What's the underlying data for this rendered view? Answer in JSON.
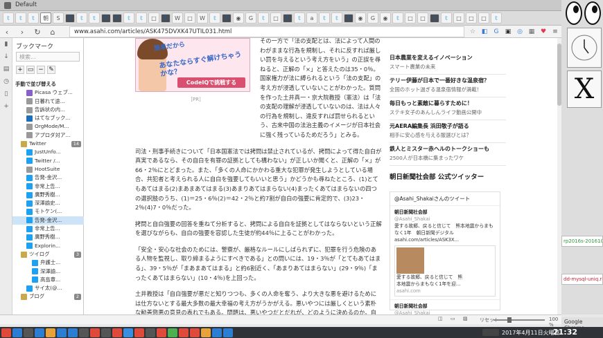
{
  "window": {
    "title": "Default"
  },
  "tabs": [
    {
      "icon": "twitter-icon",
      "glyph": "𝕥",
      "kind": "tw"
    },
    {
      "icon": "twitter-icon",
      "glyph": "𝕥",
      "kind": "tw"
    },
    {
      "icon": "twitter-icon",
      "glyph": "𝕥",
      "kind": "tw"
    },
    {
      "icon": "asahi-icon",
      "glyph": "朝",
      "kind": "",
      "active": true
    },
    {
      "icon": "s-icon",
      "glyph": "S",
      "kind": ""
    },
    {
      "icon": "tumblr-icon",
      "glyph": "t",
      "kind": "tb"
    },
    {
      "icon": "twitter-icon",
      "glyph": "𝕥",
      "kind": "tw"
    },
    {
      "icon": "twitter-icon",
      "glyph": "𝕥",
      "kind": "tw"
    },
    {
      "icon": "tumblr-icon",
      "glyph": "t",
      "kind": "tb"
    },
    {
      "icon": "tumblr-icon",
      "glyph": "t",
      "kind": "tb"
    },
    {
      "icon": "twitter-icon",
      "glyph": "𝕥",
      "kind": "tw"
    },
    {
      "icon": "twitter-icon",
      "glyph": "𝕥",
      "kind": "tw"
    },
    {
      "icon": "page-icon",
      "glyph": "□",
      "kind": ""
    },
    {
      "icon": "tumblr-icon",
      "glyph": "t",
      "kind": "tb"
    },
    {
      "icon": "wikipedia-icon",
      "glyph": "W",
      "kind": ""
    },
    {
      "icon": "page-icon",
      "glyph": "□",
      "kind": ""
    },
    {
      "icon": "wikipedia-icon",
      "glyph": "W",
      "kind": ""
    },
    {
      "icon": "twitter-icon",
      "glyph": "𝕥",
      "kind": "tw"
    },
    {
      "icon": "tumblr-icon",
      "glyph": "t",
      "kind": "tb"
    },
    {
      "icon": "github-icon",
      "glyph": "◉",
      "kind": ""
    },
    {
      "icon": "google-icon",
      "glyph": "G",
      "kind": ""
    },
    {
      "icon": "twitter-icon",
      "glyph": "𝕥",
      "kind": "tw"
    },
    {
      "icon": "page-icon",
      "glyph": "□",
      "kind": ""
    },
    {
      "icon": "tumblr-icon",
      "glyph": "t",
      "kind": "tb"
    },
    {
      "icon": "twitter-icon",
      "glyph": "𝕥",
      "kind": "tw"
    },
    {
      "icon": "amazon-icon",
      "glyph": "a",
      "kind": ""
    },
    {
      "icon": "twitter-icon",
      "glyph": "𝕥",
      "kind": "tw"
    },
    {
      "icon": "twitter-icon",
      "glyph": "𝕥",
      "kind": "tw"
    },
    {
      "icon": "tumblr-icon",
      "glyph": "t",
      "kind": "tb"
    },
    {
      "icon": "github-icon",
      "glyph": "◉",
      "kind": ""
    },
    {
      "icon": "google-icon",
      "glyph": "G",
      "kind": ""
    },
    {
      "icon": "github-icon",
      "glyph": "◉",
      "kind": ""
    },
    {
      "icon": "twitter-icon",
      "glyph": "𝕥",
      "kind": "tw"
    },
    {
      "icon": "page-icon",
      "glyph": "□",
      "kind": ""
    },
    {
      "icon": "page-icon",
      "glyph": "□",
      "kind": ""
    },
    {
      "icon": "tumblr-icon",
      "glyph": "t",
      "kind": "tb"
    },
    {
      "icon": "twitter-icon",
      "glyph": "𝕥",
      "kind": "tw"
    },
    {
      "icon": "page-icon",
      "glyph": "□",
      "kind": ""
    },
    {
      "icon": "page-icon",
      "glyph": "□",
      "kind": ""
    },
    {
      "icon": "page-icon",
      "glyph": "□",
      "kind": ""
    },
    {
      "icon": "twitter-icon",
      "glyph": "𝕥",
      "kind": "tw"
    }
  ],
  "toolbar": {
    "url": "www.asahi.com/articles/ASK475DVXK47UTIL031.html"
  },
  "bookmarks": {
    "title": "ブックマーク",
    "search_placeholder": "検索...",
    "items": [
      {
        "label": "手動で並び替える",
        "icon": "",
        "indent": 0,
        "bold": true
      },
      {
        "label": "Picasa ウェブ...",
        "icon": "picasa",
        "indent": 2
      },
      {
        "label": "日暮れて途...",
        "icon": "page",
        "indent": 2
      },
      {
        "label": "告訴状の内...",
        "icon": "page",
        "indent": 2
      },
      {
        "label": "はてなブック...",
        "icon": "hatena",
        "indent": 2
      },
      {
        "label": "OrgMode/M...",
        "icon": "page",
        "indent": 2
      },
      {
        "label": "アプロダ対ア...",
        "icon": "page",
        "indent": 2
      },
      {
        "label": "Twitter",
        "icon": "folder",
        "indent": 1,
        "badge": "14"
      },
      {
        "label": "JustUnfo...",
        "icon": "tw",
        "indent": 2
      },
      {
        "label": "Twitter /...",
        "icon": "tw",
        "indent": 2
      },
      {
        "label": "HootSuite",
        "icon": "page",
        "indent": 2
      },
      {
        "label": "告発-金沢...",
        "icon": "tw",
        "indent": 2
      },
      {
        "label": "非常上告...",
        "icon": "tw",
        "indent": 2
      },
      {
        "label": "廣野秀樹...",
        "icon": "tw",
        "indent": 2
      },
      {
        "label": "深澤諭史...",
        "icon": "tw",
        "indent": 2
      },
      {
        "label": "モトケン(...",
        "icon": "tw",
        "indent": 2
      },
      {
        "label": "告発-金沢...",
        "icon": "tw",
        "indent": 2,
        "selected": true
      },
      {
        "label": "非常上告...",
        "icon": "tw",
        "indent": 2
      },
      {
        "label": "廣野秀樹...",
        "icon": "tw",
        "indent": 2
      },
      {
        "label": "Explorin...",
        "icon": "tw",
        "indent": 2
      },
      {
        "label": "ツイログ",
        "icon": "folder",
        "indent": 1,
        "badge": "3"
      },
      {
        "label": "弁護士...",
        "icon": "tw",
        "indent": 3
      },
      {
        "label": "深澤諭...",
        "icon": "tw",
        "indent": 3
      },
      {
        "label": "高島章...",
        "icon": "tw",
        "indent": 3
      },
      {
        "label": "サイ太(@...",
        "icon": "tw",
        "indent": 2
      },
      {
        "label": "ブログ",
        "icon": "folder",
        "indent": 1,
        "badge": "2"
      }
    ]
  },
  "article": {
    "paragraphs": [
      "その一方で「法の支配とは、法によって人間のわがままな行為を規制し、それに反すれば厳しい罰を与えるという考え方をいう」の正誤を尋ねると、正解の「×」と答えたのは35・0％。国家権力が法に縛られるという「法の支配」の考え方が浸透していないことがわかった。質問を作った土井真一・京大院教授（憲法）は「法の支配の理解が浸透していないのは、法は人々の行為を規制し、違反すれば罰せられるという、古来中国の法治主義のイメージが日本社会に強く残っているためだろう」とみる。",
      "司法・刑事手続きについて「日本国憲法では拷問は禁止されているが、拷問によって得た自白が真実であるなら、その自白を有罪の証拠としても構わない」が正しいか聞くと、正解の「×」が66・2％にとどまった。また、「多くの人命にかかわる重大な犯罪が発生しようとしている場合、共犯者と考えられる人に自白を強要してもいいと思う」かどうかも尋ねたところ、(1)とてもあてはまる(2)まあまあてはまる(3)あまりあてはまらない(4)まったくあてはまらないの四つの選択肢のうち、(1)＝25・6％(2)＝42・2％と約7割が自白の強要に肯定的で、(3)23・2％(4)7・0％だった。",
      "拷問と自白強要の回答を重ねて分析すると、拷問による自白を証拠としてはならないという正解を選びながらも、自白の強要を容認した生徒が約44％に上ることがわかった。",
      "「安全・安心な社会のためには、警察が、厳格なルールにしばられずに、犯罪を行う危険のある人物を監視し、取り締まるようにすべきである」との問いには、19・3％が「とてもあてはまる」、39・5％が「まあまあてはまる」と約6割近く、「あまりあてはまらない」(29・9％)「まったくあてはまらない」(10・4％)を上回った。",
      "土井教授は「自白強要が悪だと知りつつも、多くの人命を奪う、より大きな悪を避けるためには仕方ないとする最大多数の最大幸福の考え方がうかがえる。悪いやつには厳しくという素朴な勧善懲悪の意見の表れでもある。問題は、悪いやつだとだれが、どのように決めるのか。自分が悪いやつだと決めつけられたらどうするか、その気づきをどう深めるかが指導のポイントになる」と話して"
    ],
    "ad": {
      "line1": "簡単だから",
      "line2": "あなたならすぐ解けちゃうかな？",
      "button": "CodeIQで挑戦する"
    },
    "pr": "［PR］"
  },
  "sidebar": {
    "items": [
      {
        "title": "日本農業を変えるイノベーション",
        "sub": "スマート農業の未来"
      },
      {
        "title": "テリー伊藤が日本で一番好きな温泉宿？",
        "sub": "全国のホット過ぎる温泉宿情報が満載！"
      },
      {
        "title": "毎日もっと素敵に暮らすために！",
        "sub": "ステキ女子のあんしんライフ動画公開中"
      },
      {
        "title": "元AERA編集長 浜田敬子が語る",
        "sub": "相手に安心感を与える服選びとは？"
      },
      {
        "title": "鉄人とミスター赤ヘルのトークショーも",
        "sub": "2500人が日本橋に集まったワケ"
      }
    ],
    "twitter_heading": "朝日新聞社会部 公式ツイッター",
    "twitter_tweets_by": "@Asahi_Shakaiさんのツイート",
    "tweets": [
      {
        "name": "朝日新聞社会部",
        "handle": "@Asahi_Shakai",
        "text": "愛する故郷、戻ると信じて　熊本地震からまもなく1年　朝日新聞デジタル asahi.com/articles/ASK3X...",
        "card": "愛する故郷、戻ると信じて　熊本地震からまもなく1年を迎...",
        "card_src": "asahi.com"
      },
      {
        "name": "朝日新聞社会部",
        "handle": "@Asahi_Shakai",
        "text": "",
        "card": "",
        "card_src": ""
      }
    ]
  },
  "status": {
    "reset": "リセット",
    "zoom": "100 %"
  },
  "right": {
    "term1": "rp2016s-201610",
    "term2": "dd-mysql-uniq.rb",
    "app": "Google Chrome"
  },
  "taskbar": {
    "datetime": "2017年4月11日火曜日",
    "time": "21:32"
  }
}
